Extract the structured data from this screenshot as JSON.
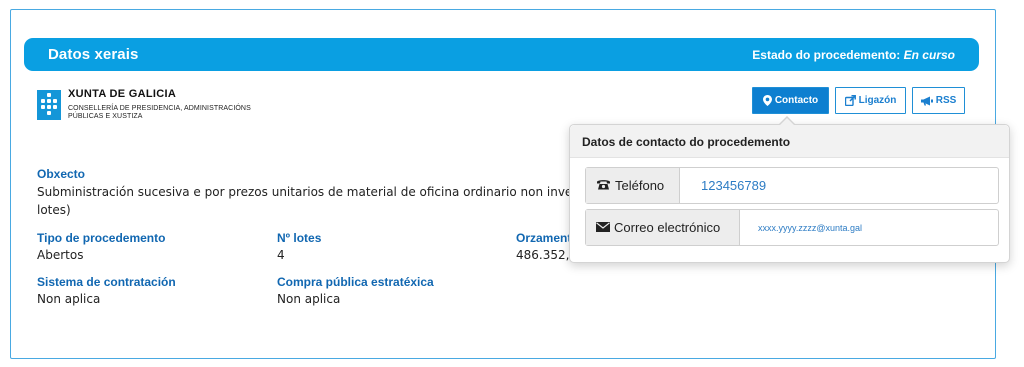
{
  "header": {
    "title": "Datos xerais",
    "status_label": "Estado do procedemento:",
    "status_value": "En curso"
  },
  "logo": {
    "title": "XUNTA DE GALICIA",
    "subtitle": "CONSELLERÍA DE PRESIDENCIA, ADMINISTRACIÓNS PÚBLICAS E XUSTIZA"
  },
  "buttons": {
    "contact": "Contacto",
    "link": "Ligazón",
    "rss": "RSS"
  },
  "fields": {
    "obxecto_label": "Obxecto",
    "obxecto_value_line1": "Subministración sucesiva e por prezos unitarios de material de oficina ordinario non inve",
    "obxecto_value_line2": "lotes)",
    "tipo_label": "Tipo de procedemento",
    "tipo_value": "Abertos",
    "lotes_label": "Nº lotes",
    "lotes_value": "4",
    "orzamento_label": "Orzament",
    "orzamento_value": "486.352,",
    "sistema_label": "Sistema de contratación",
    "sistema_value": "Non aplica",
    "compra_label": "Compra pública estratéxica",
    "compra_value": "Non aplica"
  },
  "popover": {
    "title": "Datos de contacto do procedemento",
    "phone_label": "Teléfono",
    "phone_value": "123456789",
    "email_label": "Correo electrónico",
    "email_value": "xxxx.yyyy.zzzz@xunta.gal"
  },
  "colors": {
    "header_bg": "#0a9fe2",
    "label_blue": "#1167b1",
    "button_blue": "#0d7fd0"
  }
}
